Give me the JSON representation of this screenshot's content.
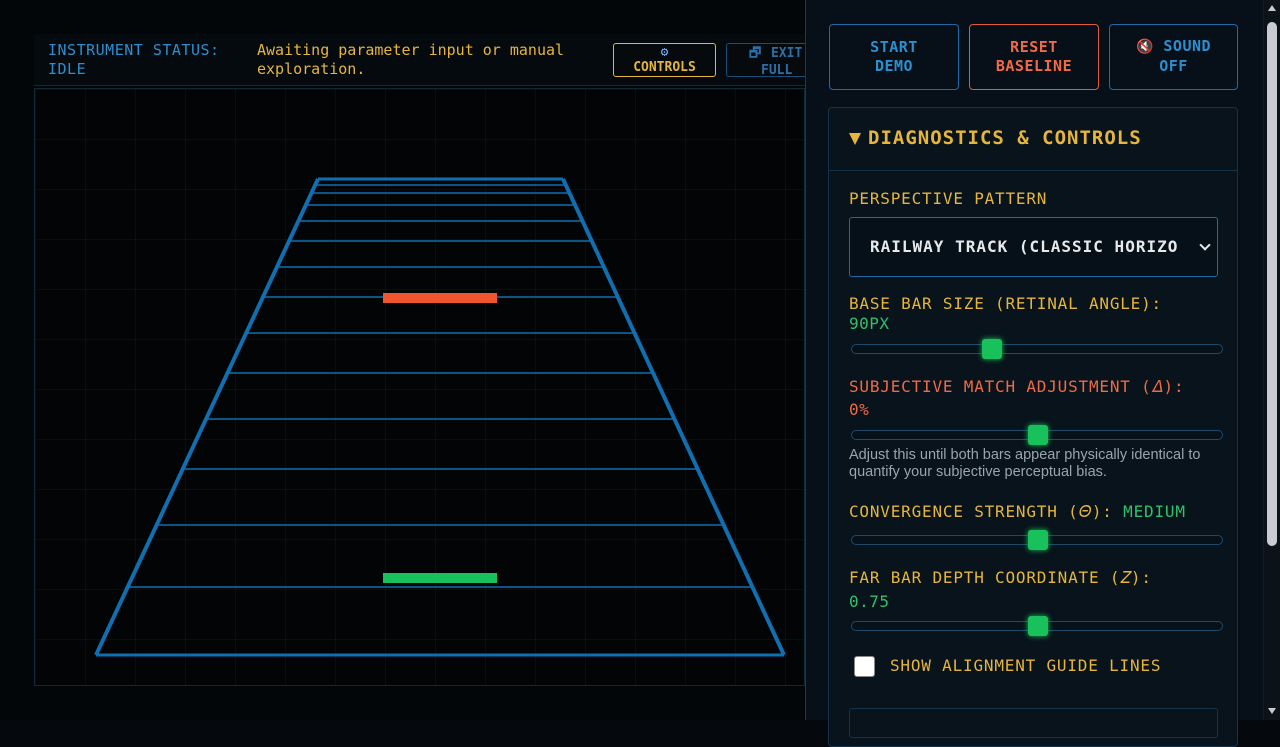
{
  "status": {
    "label_line1": "INSTRUMENT STATUS:",
    "label_line2": "IDLE",
    "message": "Awaiting parameter input or manual exploration.",
    "controls_icon": "gear-icon",
    "controls_label": "CONTROLS",
    "exit_icon": "window-restore-icon",
    "exit_label_line1": "EXIT",
    "exit_label_line2": "FULL"
  },
  "toolbar": {
    "demo_line1": "START",
    "demo_line2": "DEMO",
    "reset_line1": "RESET",
    "reset_line2": "BASELINE",
    "sound_icon": "muted-speaker-icon",
    "sound_glyph": "🔇",
    "sound_line1": "SOUND",
    "sound_line2": "OFF"
  },
  "panel": {
    "title": "DIAGNOSTICS & CONTROLS",
    "pattern_label": "PERSPECTIVE PATTERN",
    "pattern_value": "RAILWAY TRACK (CLASSIC HORIZO",
    "base_label": "BASE BAR SIZE (RETINAL ANGLE):",
    "base_value": "90PX",
    "base_level": 0.37,
    "match_label": "SUBJECTIVE MATCH ADJUSTMENT (𝛥):",
    "match_value": "0%",
    "match_level": 0.5,
    "match_hint": "Adjust this until both bars appear physically identical to quantify your subjective perceptual bias.",
    "conv_label": "CONVERGENCE STRENGTH (𝛩):",
    "conv_value": "MEDIUM",
    "conv_level": 0.5,
    "depth_label": "FAR BAR DEPTH COORDINATE (𝑍):",
    "depth_value": "0.75",
    "depth_level": 0.5,
    "guides_label": "SHOW ALIGNMENT GUIDE LINES",
    "guides_checked": false
  },
  "colors": {
    "accent_gold": "#e5b53c",
    "accent_blue": "#2b8fd0",
    "near_bar": "#19c15a",
    "far_bar": "#f0552e",
    "track": "#0f6fb0"
  }
}
